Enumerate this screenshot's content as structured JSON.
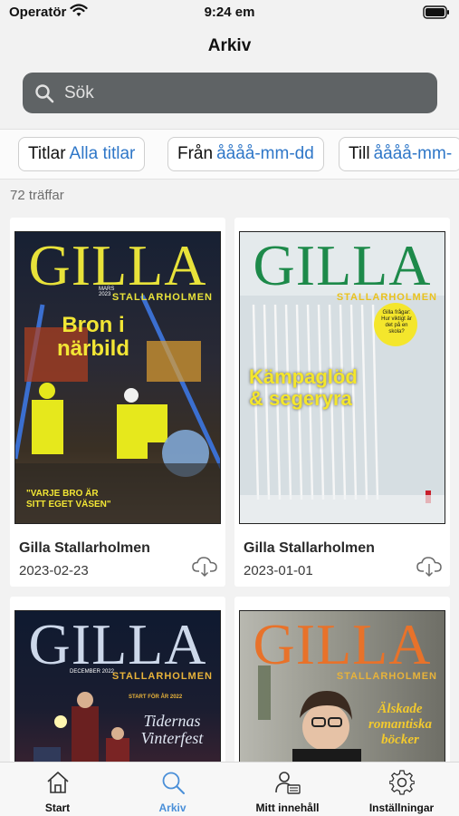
{
  "status_bar": {
    "carrier": "Operatör",
    "time": "9:24 em"
  },
  "nav": {
    "title": "Arkiv"
  },
  "search": {
    "placeholder": "Sök"
  },
  "filters": [
    {
      "label": "Titlar",
      "value": "Alla titlar"
    },
    {
      "label": "Från",
      "value": "åååå-mm-dd"
    },
    {
      "label": "Till",
      "value": "åååå-mm-"
    }
  ],
  "results": {
    "count_text": "72 träffar"
  },
  "issues": [
    {
      "title": "Gilla Stallarholmen",
      "date": "2023-02-23",
      "cover": {
        "masthead": "GILLA",
        "sub": "STALLARHOLMEN",
        "month": "MARS 2023",
        "headline": "Bron i närbild",
        "bg": "#1a2436",
        "mast_color": "#e8e23a",
        "head_color": "#f2e635",
        "tagline": "\"VARJE BRO ÄR SITT EGET VÄSEN\""
      }
    },
    {
      "title": "Gilla Stallarholmen",
      "date": "2023-01-01",
      "cover": {
        "masthead": "GILLA",
        "sub": "STALLARHOLMEN",
        "headline": "Kämpaglöd & segeryra",
        "bg": "#dfe6e8",
        "mast_color": "#1d8a4a",
        "head_color": "#f4e62c",
        "badge": "Gilla frågar: Hur viktigt är det på en skola?"
      }
    },
    {
      "cover": {
        "masthead": "GILLA",
        "sub": "STALLARHOLMEN",
        "month": "DECEMBER 2022",
        "headline": "Tidernas Vinterfest",
        "kicker": "START FÖR ÅR 2022",
        "bg": "#10182a",
        "mast_color": "#cdd8ea",
        "head_color": "#dfe6f2"
      }
    },
    {
      "cover": {
        "masthead": "GILLA",
        "sub": "STALLARHOLMEN",
        "headline": "Älskade romantiska böcker",
        "bg": "#8a8c86",
        "mast_color": "#e8722a",
        "head_color": "#f2c92e"
      }
    }
  ],
  "tabs": [
    {
      "label": "Start",
      "icon": "home-icon",
      "active": false
    },
    {
      "label": "Arkiv",
      "icon": "search-icon",
      "active": true
    },
    {
      "label": "Mitt innehåll",
      "icon": "person-content-icon",
      "active": false
    },
    {
      "label": "Inställningar",
      "icon": "gear-icon",
      "active": false
    }
  ],
  "colors": {
    "accent": "#2f77c8",
    "tab_active": "#4a8fd8",
    "search_bg": "#5f6365"
  }
}
